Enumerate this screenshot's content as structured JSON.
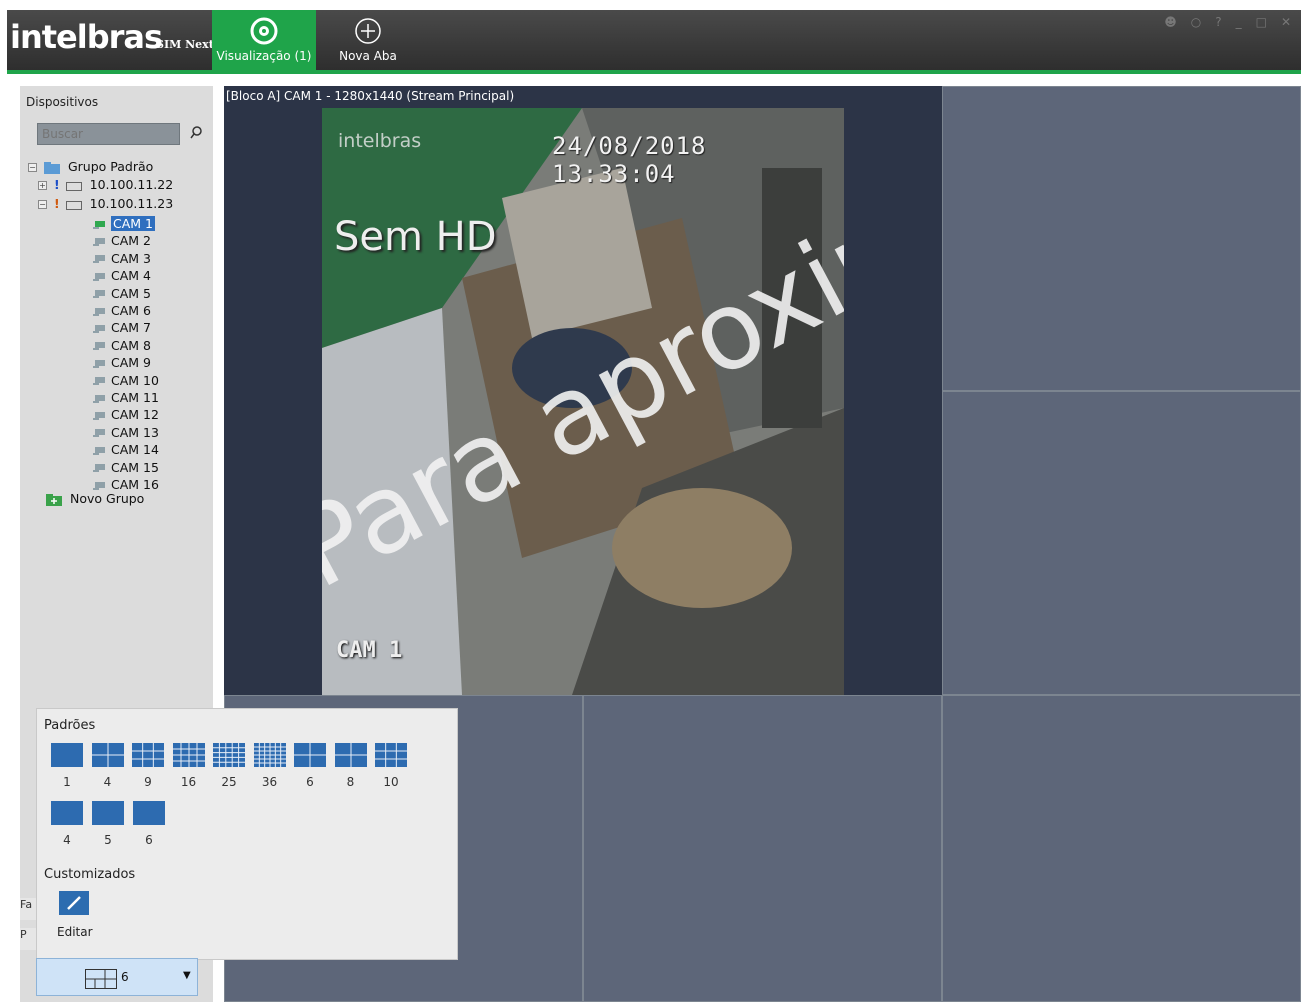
{
  "app": {
    "logo": "intelbras",
    "logo_sub": "SIM Next",
    "tabs": [
      {
        "label": "Visualização (1)",
        "icon": "eye-icon",
        "active": true
      },
      {
        "label": "Nova Aba",
        "icon": "plus-circle-icon",
        "active": false
      }
    ],
    "accent": "#1fa44a"
  },
  "sidebar": {
    "title": "Dispositivos",
    "search_placeholder": "Buscar",
    "group": "Grupo Padrão",
    "devices": [
      "10.100.11.22",
      "10.100.11.23"
    ],
    "cameras": [
      "CAM 1",
      "CAM 2",
      "CAM 3",
      "CAM 4",
      "CAM 5",
      "CAM 6",
      "CAM 7",
      "CAM 8",
      "CAM 9",
      "CAM 10",
      "CAM 11",
      "CAM 12",
      "CAM 13",
      "CAM 14",
      "CAM 15",
      "CAM 16"
    ],
    "selected_camera": "CAM 1",
    "new_group": "Novo Grupo",
    "side_labels": [
      "Fa",
      "P"
    ]
  },
  "layout_select": {
    "value": "6"
  },
  "video": {
    "main_title": "[Bloco A] CAM 1 - 1280x1440 (Stream Principal)",
    "feed_logo": "intelbras",
    "timestamp": "24/08/2018 13:33:04",
    "hd_label": "Sem HD",
    "overlay": "Para aproxim",
    "cam_label": "CAM 1"
  },
  "layout_popup": {
    "standard_title": "Padrões",
    "standard_row1": [
      "1",
      "4",
      "9",
      "16",
      "25",
      "36",
      "6",
      "8",
      "10"
    ],
    "standard_row2": [
      "4",
      "5",
      "6"
    ],
    "custom_title": "Customizados",
    "edit_label": "Editar"
  }
}
